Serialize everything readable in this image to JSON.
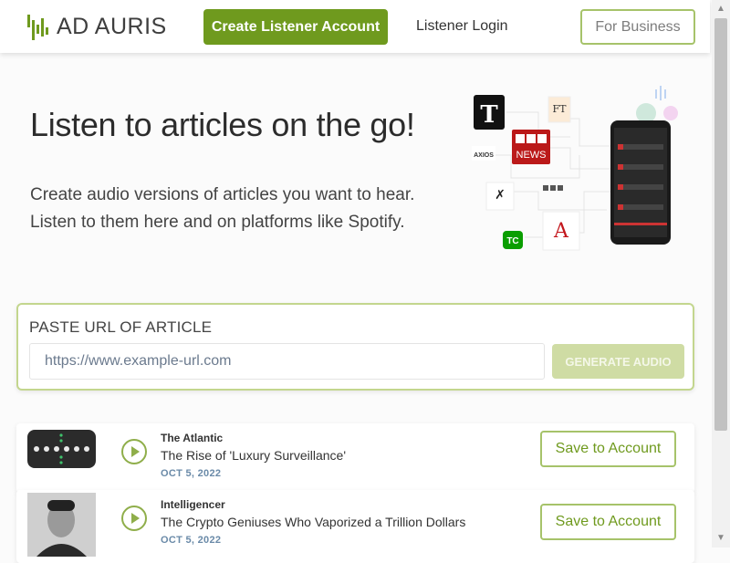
{
  "header": {
    "logo_text": "AD AURIS",
    "create_account_label": "Create Listener Account",
    "login_label": "Listener Login",
    "business_label": "For Business"
  },
  "hero": {
    "title": "Listen to articles on the go!",
    "subtitle_line1": "Create audio versions of articles you want to hear.",
    "subtitle_line2": "Listen to them here and on platforms like Spotify.",
    "logos": [
      "BBC NEWS",
      "FT",
      "AXIOS",
      "TC",
      "A"
    ]
  },
  "url_form": {
    "label": "PASTE URL OF ARTICLE",
    "placeholder": "https://www.example-url.com",
    "value": "",
    "generate_label": "GENERATE AUDIO"
  },
  "articles": [
    {
      "source": "The Atlantic",
      "title": "The Rise of 'Luxury Surveillance'",
      "date": "OCT 5, 2022",
      "save_label": "Save to Account"
    },
    {
      "source": "Intelligencer",
      "title": "The Crypto Geniuses Who Vaporized a Trillion Dollars",
      "date": "OCT 5, 2022",
      "save_label": "Save to Account"
    }
  ],
  "colors": {
    "brand_green": "#6f9a1e",
    "light_green": "#a6c36a",
    "disabled_green": "#cfdca4",
    "date_blue": "#6a8aa8"
  },
  "icons": [
    "logo-bars-icon",
    "play-icon",
    "scroll-up-arrow-icon",
    "scroll-down-arrow-icon"
  ]
}
